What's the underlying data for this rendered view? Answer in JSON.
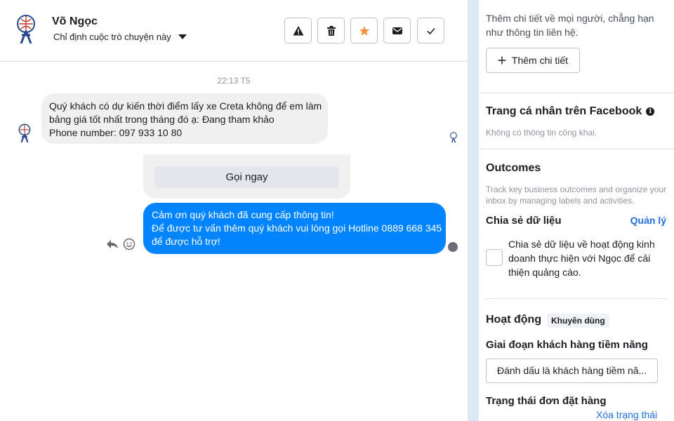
{
  "header": {
    "contact_name": "Võ Ngọc",
    "assign_label": "Chỉ định cuộc trò chuyện này",
    "buttons": [
      {
        "name": "report-button",
        "icon": "warning-icon"
      },
      {
        "name": "delete-button",
        "icon": "trash-icon"
      },
      {
        "name": "star-button",
        "icon": "star-icon",
        "color": "#f7923b"
      },
      {
        "name": "mark-unread-button",
        "icon": "envelope-icon"
      },
      {
        "name": "mark-done-button",
        "icon": "check-icon"
      }
    ]
  },
  "conversation": {
    "timestamp": "22:13 T5",
    "incoming": {
      "lines": [
        "Quý khách có dự kiến thời điểm lấy xe Creta không để em làm",
        "bảng giá tốt nhất trong tháng đó ạ: Đang tham khảo",
        "Phone number: 097 933 10 80"
      ]
    },
    "cta_button": "Gọi ngay",
    "outgoing": {
      "lines": [
        "Cảm ơn quý khách đã cung cấp thông tin!",
        "Để được tư vấn thêm quý khách vui lòng gọi Hotline 0889 668 345",
        "để được hỗ trợ!"
      ],
      "color": "#0084ff"
    }
  },
  "sidebar": {
    "details": {
      "description": [
        "Thêm chi tiết về mọi người, chẳng hạn",
        "như thông tin liên hệ."
      ],
      "add_button": "Thêm chi tiết"
    },
    "facebook_profile": {
      "title": "Trang cá nhân trên Facebook",
      "subtitle": "Không có thông tin công khai."
    },
    "outcomes": {
      "title": "Outcomes",
      "description": [
        "Track key business outcomes and organize your",
        "inbox by managing labels and activities."
      ]
    },
    "data_sharing": {
      "title": "Chia sẻ dữ liệu",
      "manage_link": "Quản lý",
      "checkbox_lines": [
        "Chia sẻ dữ liệu về hoạt động kinh",
        "doanh thực hiện với Ngọc để cải",
        "thiện quảng cáo."
      ]
    },
    "activity": {
      "title": "Hoạt động",
      "badge": "Khuyên dùng",
      "lead_stage_label": "Giai đoạn khách hàng tiềm năng",
      "lead_stage_value": "Đánh dấu là khách hàng tiềm nă...",
      "order_status_label": "Trạng thái đơn đặt hàng",
      "clear_status_link": "Xóa trạng thái"
    }
  },
  "colors": {
    "accent": "#216fdb",
    "messenger_blue": "#0084ff",
    "divider_strip": "#dde8f5"
  }
}
